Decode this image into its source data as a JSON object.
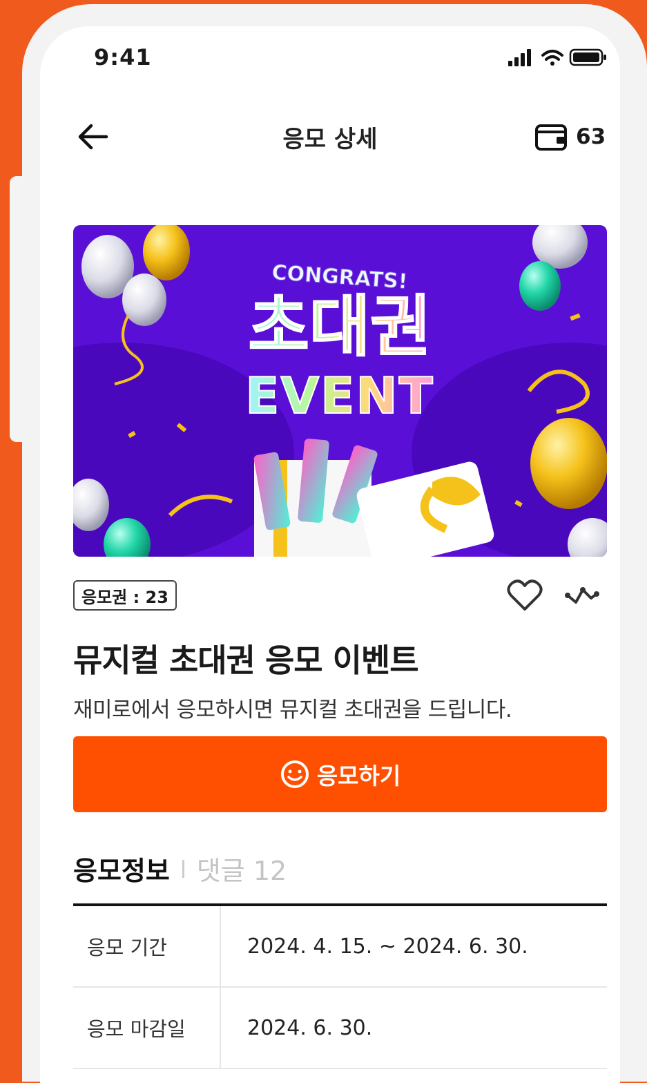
{
  "status_bar": {
    "time": "9:41"
  },
  "header": {
    "title": "응모 상세",
    "wallet_count": "63"
  },
  "banner": {
    "small_text": "CONGRATS!",
    "main_text": "초대권",
    "sub_text": "EVENT"
  },
  "ticket_badge": "응모권 : 23",
  "event": {
    "title": "뮤지컬 초대권 응모 이벤트",
    "description": "재미로에서 응모하시면 뮤지컬 초대권을 드립니다."
  },
  "apply_button": {
    "label": "응모하기"
  },
  "tabs": {
    "info": "응모정보",
    "comments": "댓글 12"
  },
  "info_rows": [
    {
      "label": "응모 기간",
      "value": "2024. 4. 15. ~ 2024. 6. 30."
    },
    {
      "label": "응모 마감일",
      "value": "2024. 6. 30."
    }
  ],
  "colors": {
    "accent": "#ff4f00",
    "background": "#f05a1c",
    "banner_purple": "#5a0fd6"
  }
}
